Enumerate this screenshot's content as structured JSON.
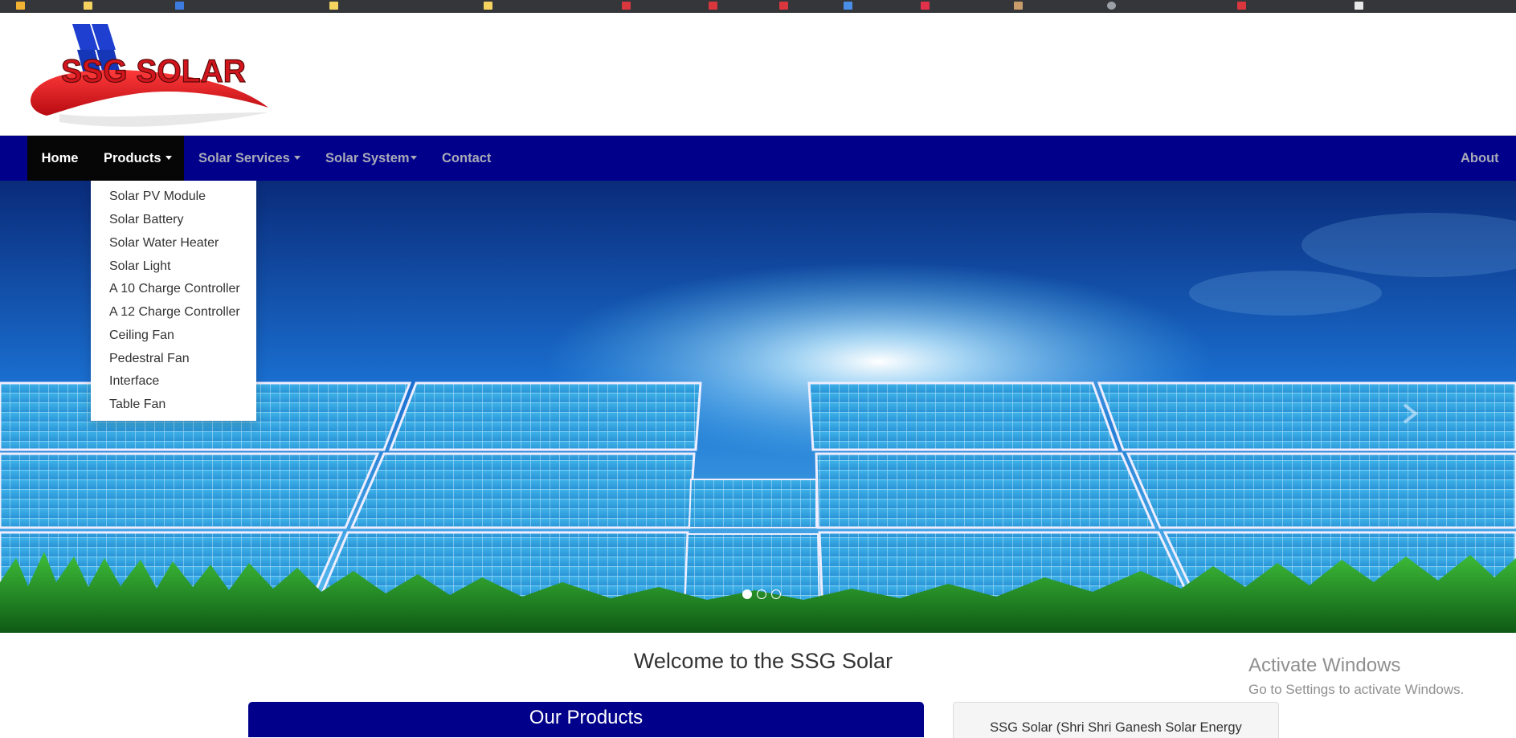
{
  "header": {
    "logo_text": "SSG SOLAR",
    "brand_red": "#d2151d",
    "brand_blue": "#1233c5"
  },
  "nav": {
    "bg_color": "#00008b",
    "home": "Home",
    "products": "Products",
    "solar_services": "Solar Services",
    "solar_system": "Solar System",
    "contact": "Contact",
    "about": "About"
  },
  "products_menu": {
    "items": [
      "Solar PV Module",
      "Solar Battery",
      "Solar Water Heater",
      "Solar Light",
      "A 10 Charge Controller",
      "A 12 Charge Controller",
      "Ceiling Fan",
      "Pedestral Fan",
      "Interface",
      "Table Fan"
    ]
  },
  "carousel": {
    "slide_count": 3,
    "active_slide": 1
  },
  "main": {
    "welcome": "Welcome to the SSG Solar",
    "our_products": "Our Products",
    "side_text": "SSG Solar (Shri Shri Ganesh Solar Energy"
  },
  "watermark": {
    "title": "Activate Windows",
    "subtitle": "Go to Settings to activate Windows."
  }
}
